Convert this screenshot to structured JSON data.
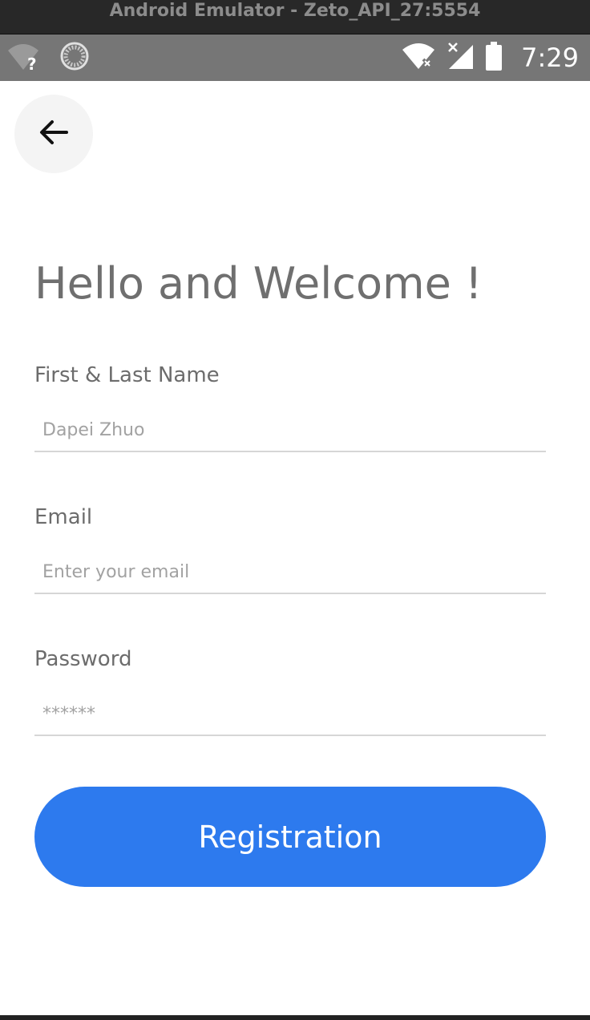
{
  "window": {
    "title": "Android Emulator - Zeto_API_27:5554"
  },
  "status_bar": {
    "time": "7:29",
    "icons": [
      "wifi-unknown-icon",
      "sync-icon",
      "wifi-no-internet-icon",
      "no-signal-icon",
      "battery-icon"
    ]
  },
  "header": {
    "back_icon": "arrow-left-icon"
  },
  "main": {
    "title": "Hello and Welcome !",
    "name_field": {
      "label": "First & Last Name",
      "placeholder": "Dapei Zhuo"
    },
    "email_field": {
      "label": "Email",
      "placeholder": "Enter your email"
    },
    "password_field": {
      "label": "Password",
      "placeholder": "******"
    },
    "register_button": {
      "label": "Registration"
    }
  },
  "colors": {
    "accent": "#2d7aee",
    "status_bar": "#767676",
    "title_bar": "#282828",
    "text": "#6f6f6f"
  }
}
